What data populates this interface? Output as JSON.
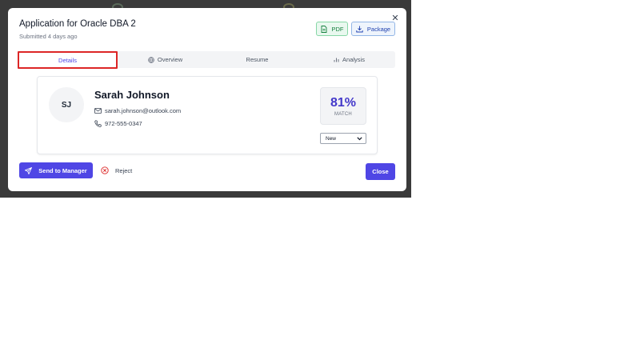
{
  "modal": {
    "title": "Application for Oracle DBA 2",
    "subtitle": "Submitted 4 days ago",
    "close_icon": "close-icon",
    "pdf_label": "PDF",
    "package_label": "Package"
  },
  "tabs": [
    {
      "label": "Details",
      "active": true
    },
    {
      "label": "Overview",
      "icon": "globe-icon"
    },
    {
      "label": "Resume"
    },
    {
      "label": "Analysis",
      "icon": "bar-chart-icon"
    }
  ],
  "candidate": {
    "initials": "SJ",
    "name": "Sarah Johnson",
    "email": "sarah.johnson@outlook.com",
    "phone": "972-555-0347",
    "match_percent": "81%",
    "match_label": "MATCH",
    "status": "New"
  },
  "actions": {
    "send_label": "Send to Manager",
    "reject_label": "Reject",
    "close_label": "Close"
  },
  "colors": {
    "primary": "#4f46e5",
    "pdf": "#15803d",
    "package": "#1e40af",
    "reject": "#dc2626",
    "highlight": "#dc2626"
  }
}
